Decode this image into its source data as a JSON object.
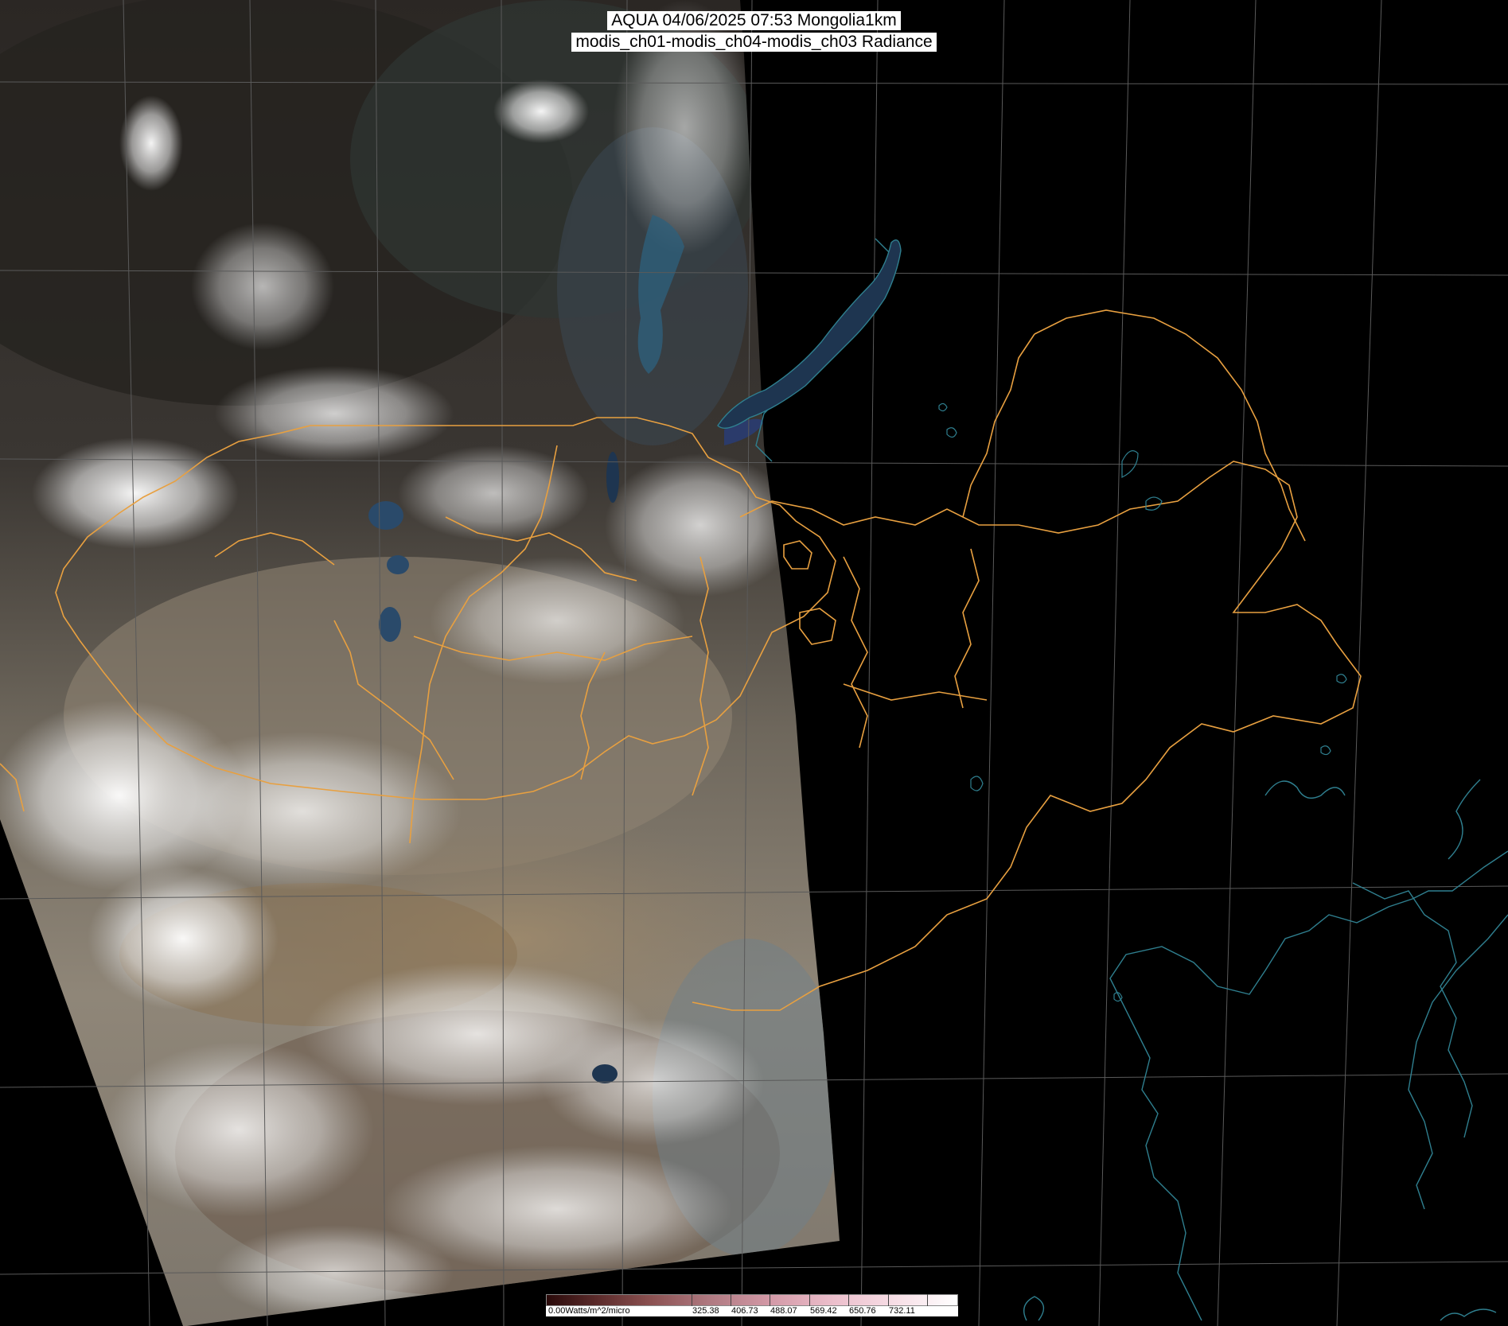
{
  "header": {
    "title_line_1": "AQUA 04/06/2025 07:53 Mongolia1km",
    "title_line_2": "modis_ch01-modis_ch04-modis_ch03 Radiance"
  },
  "colorbar": {
    "labels": [
      "0.00Watts/m^2/micro",
      "325.38",
      "406.73",
      "488.07",
      "569.42",
      "650.76",
      "732.11"
    ]
  },
  "colors": {
    "background": "#000000",
    "grid": "#5a5a5a",
    "admin_border": "#e8a040",
    "coastline": "#2f7f8f"
  },
  "map_features": [
    "satellite-swath",
    "lat-lon-grid",
    "admin-borders",
    "coastlines",
    "lake-baikal",
    "lakes",
    "cloud-cover"
  ]
}
